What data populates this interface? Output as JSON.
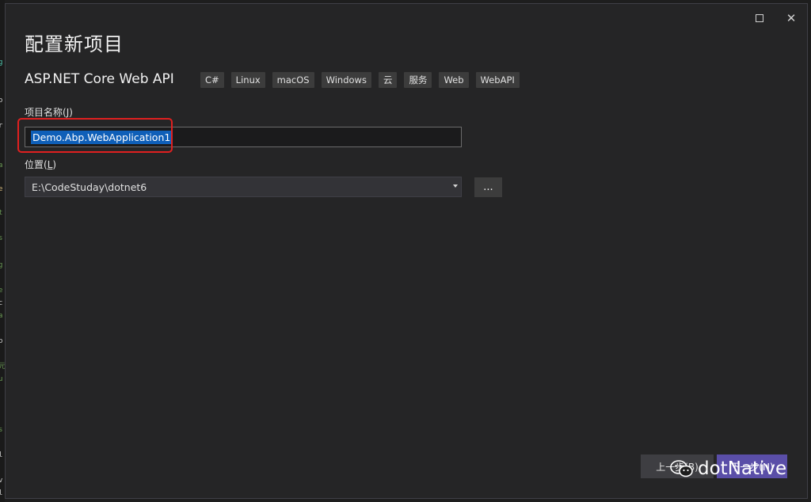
{
  "window": {
    "title": "配置新项目",
    "maximize_icon": "maximize-icon",
    "close_glyph": "✕"
  },
  "template": {
    "name": "ASP.NET Core Web API",
    "tags": [
      "C#",
      "Linux",
      "macOS",
      "Windows",
      "云",
      "服务",
      "Web",
      "WebAPI"
    ]
  },
  "project_name": {
    "label": "项目名称",
    "accesskey": "J",
    "value": "Demo.Abp.WebApplication1"
  },
  "location": {
    "label": "位置",
    "accesskey": "L",
    "value": "E:\\CodeStuday\\dotnet6",
    "browse_label": "..."
  },
  "footer": {
    "back_label": "上一步(B)",
    "next_label": "下一步(N)"
  },
  "watermark": {
    "text": "dotNative",
    "icon": "wechat-icon"
  },
  "colors": {
    "background": "#252526",
    "accent": "#5a4ea8",
    "selection": "#0f5fb8",
    "highlight": "#e02020"
  },
  "code_strip": [
    {
      "ch": "g",
      "color": "#4ec9b0"
    },
    {
      "ch": "o",
      "color": "#cccccc"
    },
    {
      "ch": "r",
      "color": "#cccccc"
    },
    {
      "ch": "a",
      "color": "#6a9955"
    },
    {
      "ch": "e",
      "color": "#d7ba7d"
    },
    {
      "ch": "t",
      "color": "#6a9955"
    },
    {
      "ch": "s",
      "color": "#6a9955"
    },
    {
      "ch": "g",
      "color": "#6a9955"
    },
    {
      "ch": "e",
      "color": "#6a9955"
    },
    {
      "ch": "c",
      "color": "#cccccc"
    },
    {
      "ch": "a",
      "color": "#6a9955"
    },
    {
      "ch": "p",
      "color": "#cccccc"
    },
    {
      "ch": "元",
      "color": "#6a9955"
    },
    {
      "ch": "u",
      "color": "#6a9955"
    },
    {
      "ch": "s",
      "color": "#6a9955"
    },
    {
      "ch": "l",
      "color": "#cccccc"
    },
    {
      "ch": "v",
      "color": "#cccccc"
    },
    {
      "ch": "l",
      "color": "#cccccc"
    }
  ]
}
